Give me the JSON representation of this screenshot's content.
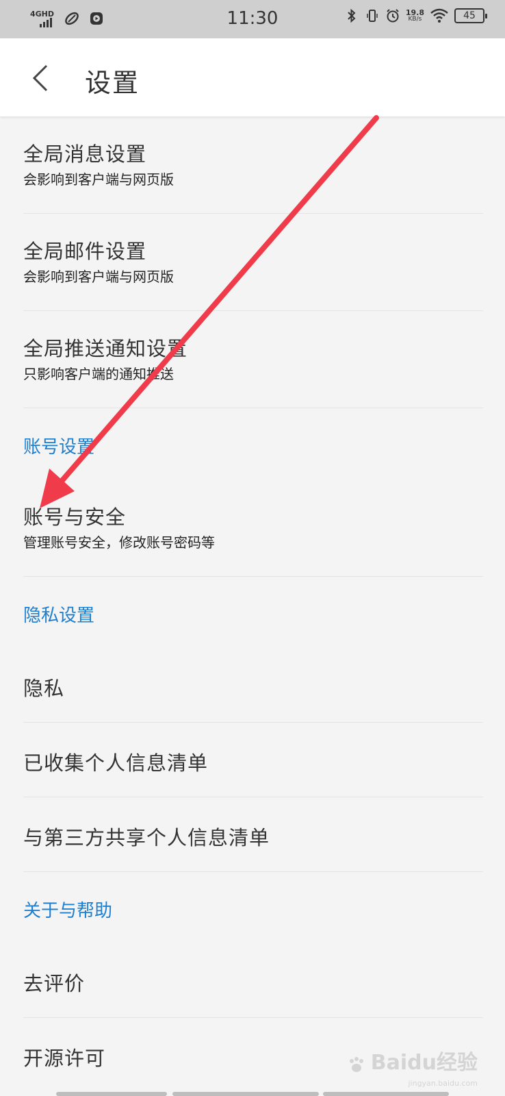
{
  "status_bar": {
    "network": "4GHD",
    "time": "11:30",
    "speed_value": "19.8",
    "speed_unit": "KB/s",
    "battery": "45"
  },
  "header": {
    "title": "设置"
  },
  "items": {
    "global_message": {
      "title": "全局消息设置",
      "subtitle": "会影响到客户端与网页版"
    },
    "global_mail": {
      "title": "全局邮件设置",
      "subtitle": "会影响到客户端与网页版"
    },
    "global_push": {
      "title": "全局推送通知设置",
      "subtitle": "只影响客户端的通知推送"
    },
    "account_security": {
      "title": "账号与安全",
      "subtitle": "管理账号安全，修改账号密码等"
    },
    "privacy": {
      "title": "隐私"
    },
    "collected_info": {
      "title": "已收集个人信息清单"
    },
    "third_party_info": {
      "title": "与第三方共享个人信息清单"
    },
    "rate": {
      "title": "去评价"
    },
    "open_source": {
      "title": "开源许可"
    }
  },
  "sections": {
    "account": "账号设置",
    "privacy": "隐私设置",
    "about": "关于与帮助"
  },
  "colors": {
    "section_label": "#1e7fd0",
    "annotation_arrow": "#ef3b4a"
  },
  "watermark": {
    "text": "Baidu经验",
    "sub": "jingyan.baidu.com"
  }
}
